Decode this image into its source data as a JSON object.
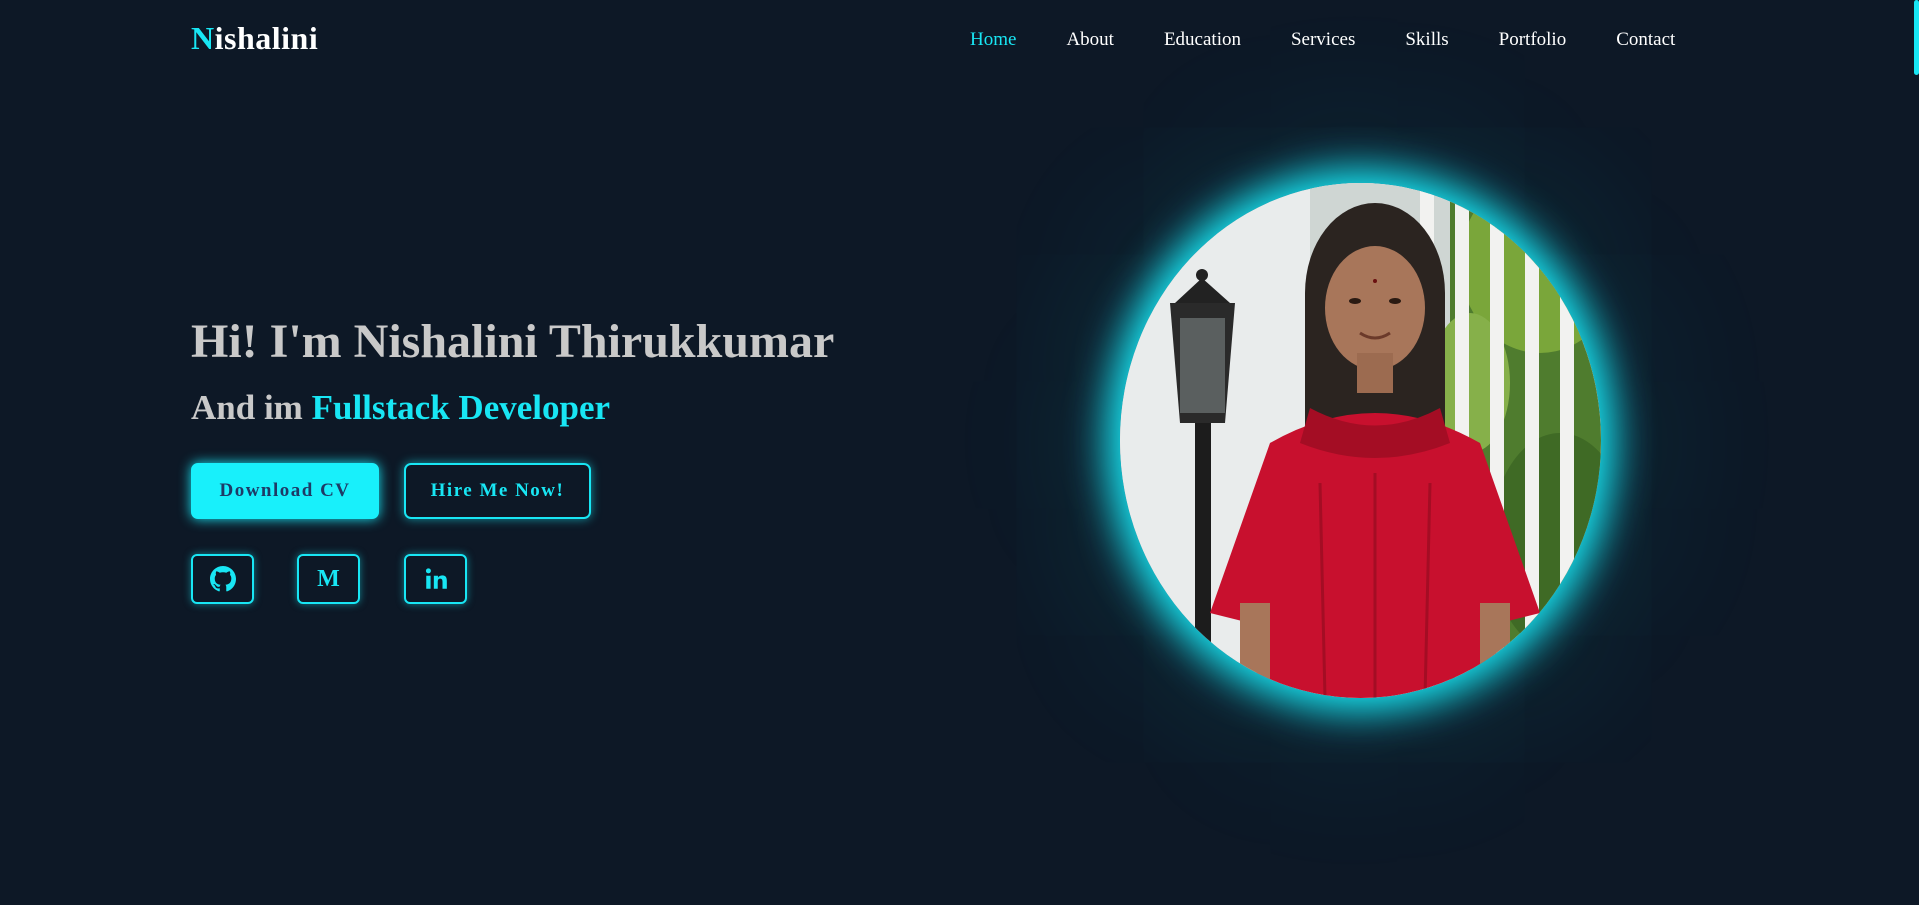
{
  "logo": {
    "initial": "N",
    "rest": "ishalini"
  },
  "nav": {
    "items": [
      {
        "label": "Home",
        "active": true
      },
      {
        "label": "About"
      },
      {
        "label": "Education"
      },
      {
        "label": "Services"
      },
      {
        "label": "Skills"
      },
      {
        "label": "Portfolio"
      },
      {
        "label": "Contact"
      }
    ]
  },
  "hero": {
    "title": "Hi! I'm Nishalini Thirukkumar",
    "subtitle_prefix": "And im ",
    "subtitle_role": "Fullstack Developer",
    "primary_button": "Download CV",
    "secondary_button": "Hire Me Now!",
    "medium_letter": "M"
  },
  "social": {
    "icons": [
      "github-icon",
      "medium-icon",
      "linkedin-icon"
    ]
  },
  "colors": {
    "background": "#0d1826",
    "accent": "#18e6f4",
    "text_muted": "#c9c9c9",
    "white": "#ffffff"
  }
}
